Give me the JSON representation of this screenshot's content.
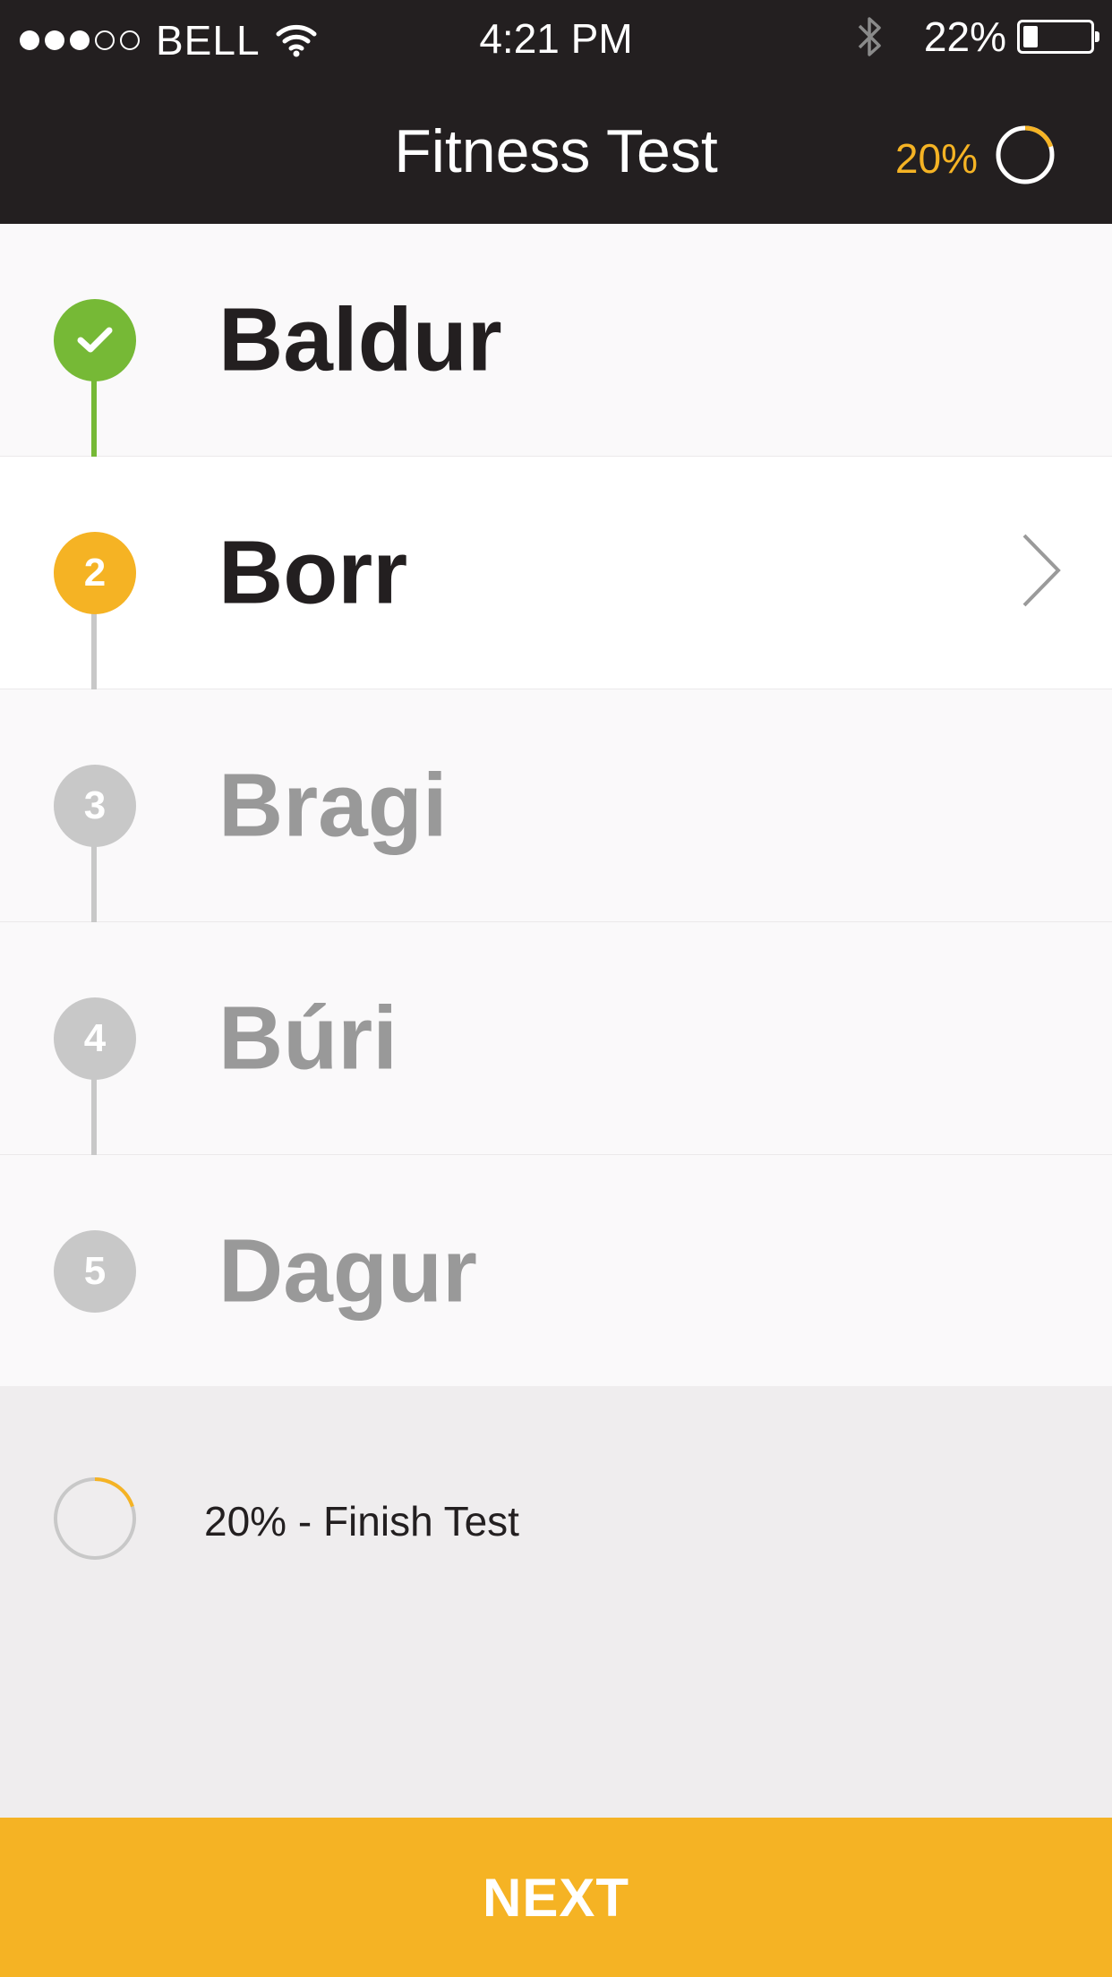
{
  "status_bar": {
    "signal_full": 3,
    "signal_total": 5,
    "carrier": "BELL",
    "time": "4:21 PM",
    "battery_pct": "22%",
    "battery_level": 0.22,
    "icons": [
      "wifi-icon",
      "bluetooth-icon",
      "battery-icon"
    ]
  },
  "header": {
    "title": "Fitness Test",
    "progress_label": "20%",
    "progress_value": 0.2
  },
  "steps": [
    {
      "badge": "",
      "name": "Baldur",
      "state": "done"
    },
    {
      "badge": "2",
      "name": "Borr",
      "state": "active"
    },
    {
      "badge": "3",
      "name": "Bragi",
      "state": "pending"
    },
    {
      "badge": "4",
      "name": "Búri",
      "state": "pending"
    },
    {
      "badge": "5",
      "name": "Dagur",
      "state": "pending"
    }
  ],
  "finish": {
    "label": "20% - Finish Test",
    "progress_value": 0.2
  },
  "next_button": {
    "label": "NEXT"
  },
  "colors": {
    "accent": "#f5b324",
    "done": "#76b936",
    "pending": "#c8c8c8",
    "dark": "#231f20"
  }
}
